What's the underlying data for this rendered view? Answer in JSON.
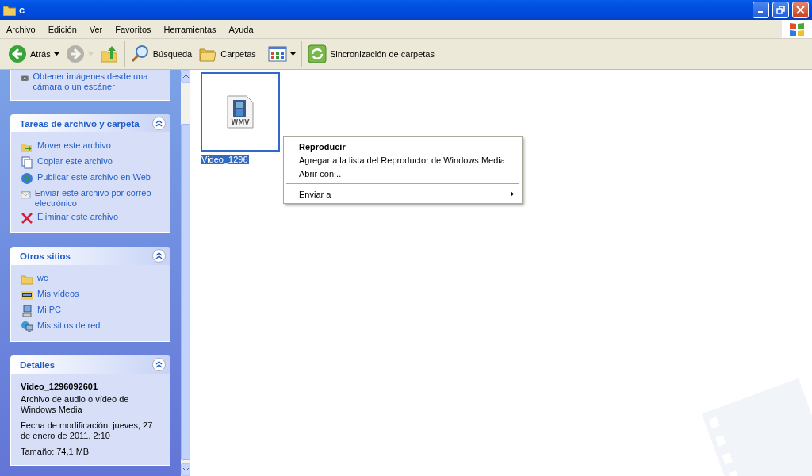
{
  "window": {
    "title": "c"
  },
  "menu_bar": [
    "Archivo",
    "Edición",
    "Ver",
    "Favoritos",
    "Herramientas",
    "Ayuda"
  ],
  "toolbar": [
    {
      "kind": "back",
      "label": "Atrás",
      "disabled": false
    },
    {
      "kind": "forward",
      "disabled": true
    },
    {
      "kind": "up",
      "disabled": false
    },
    {
      "kind": "separator"
    },
    {
      "kind": "search",
      "label": "Búsqueda",
      "disabled": false
    },
    {
      "kind": "folders",
      "label": "Carpetas",
      "disabled": false
    },
    {
      "kind": "separator"
    },
    {
      "kind": "views",
      "disabled": false
    },
    {
      "kind": "separator"
    },
    {
      "kind": "sync",
      "label": "Sincronización de carpetas",
      "disabled": false
    }
  ],
  "task_panes": [
    {
      "items": [
        {
          "kind": "camera",
          "label": "Obtener imágenes desde una cámara o un escáner"
        }
      ]
    },
    {
      "title": "Tareas de archivo y carpeta",
      "expanded": true,
      "items": [
        {
          "kind": "move",
          "label": "Mover este archivo"
        },
        {
          "kind": "copy",
          "label": "Copiar este archivo"
        },
        {
          "kind": "globe",
          "label": "Publicar este archivo en Web"
        },
        {
          "kind": "mail",
          "label": "Enviar este archivo por correo electrónico"
        },
        {
          "kind": "delete",
          "label": "Eliminar este archivo"
        }
      ]
    },
    {
      "title": "Otros sitios",
      "expanded": true,
      "items": [
        {
          "kind": "folder",
          "label": "wc"
        },
        {
          "kind": "film",
          "label": "Mis vídeos"
        },
        {
          "kind": "computer",
          "label": "Mi PC"
        },
        {
          "kind": "network",
          "label": "Mis sitios de red"
        }
      ]
    },
    {
      "title": "Detalles",
      "expanded": true,
      "details": {
        "name": "Video_1296092601",
        "type": "Archivo de audio o vídeo de Windows Media",
        "modified": "Fecha de modificación: jueves, 27 de enero de 2011, 2:10",
        "size": "Tamaño: 74,1 MB"
      }
    }
  ],
  "files": [
    {
      "label": "Video_1296",
      "badge": "WMV",
      "selected": true
    }
  ],
  "context_menu": [
    {
      "kind": "item",
      "label": "Reproducir",
      "default": true,
      "submenu": false
    },
    {
      "kind": "item",
      "label": "Agregar a la lista del Reproductor de Windows Media",
      "default": false,
      "submenu": false
    },
    {
      "kind": "item",
      "label": "Abrir con...",
      "default": false,
      "submenu": false
    },
    {
      "kind": "separator"
    },
    {
      "kind": "item",
      "label": "Enviar a",
      "default": false,
      "submenu": true
    }
  ]
}
